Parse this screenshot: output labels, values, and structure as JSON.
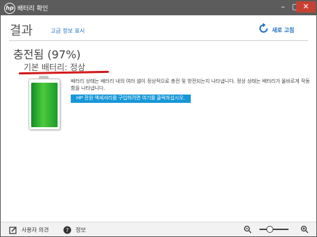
{
  "window": {
    "title": "배터리 확인"
  },
  "header": {
    "title": "결과",
    "advanced_link": "고급 정보 표시",
    "refresh_label": "새로 고침"
  },
  "result": {
    "status": "충전됨 (97%)",
    "primary_label": "기본 배터리: 정상",
    "description": "배터리 상태는 배터리 내의 여러 셀이 정상적으로 충전 및 방전되는지 나타냅니다. 정상 상태는 배터리가 올바르게 작동함을 나타냅니다.",
    "hp_button": "HP 전원 액세서리를 구입하려면 여기를 클릭하십시오.",
    "charge_percent": 97
  },
  "footer": {
    "feedback_label": "사용자 의견",
    "info_label": "정보"
  },
  "colors": {
    "titlebar": "#5c5c5c",
    "accent": "#1e70c1",
    "button": "#1797d8",
    "battery_green": "#2db535",
    "underline": "#d11a1a"
  },
  "icons": [
    "hp-logo",
    "minimize-icon",
    "maximize-icon",
    "close-icon",
    "refresh-icon",
    "feedback-icon",
    "info-icon",
    "zoom-out-icon",
    "zoom-in-icon"
  ]
}
